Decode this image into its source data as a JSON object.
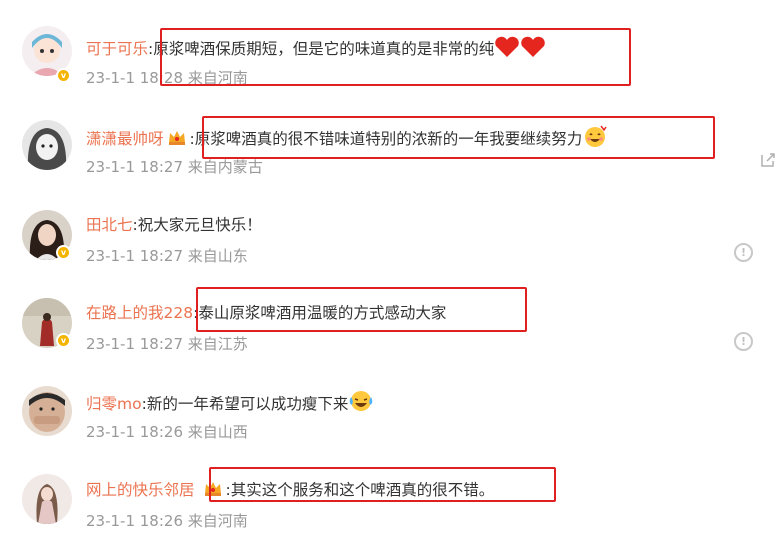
{
  "comments": [
    {
      "user": "可于可乐",
      "text": ":原浆啤酒保质期短，但是它的味道真的是非常的纯",
      "time": "23-1-1 18:28",
      "location": "来自河南",
      "avatar_color": "#e9a7b0"
    },
    {
      "user": "潇潇最帅呀",
      "text": ":原浆啤酒真的很不错味道特别的浓新的一年我要继续努力",
      "time": "23-1-1 18:27",
      "location": "来自内蒙古",
      "avatar_color": "#9a9a9a"
    },
    {
      "user": "田北七",
      "text": ":祝大家元旦快乐！",
      "time": "23-1-1 18:27",
      "location": "来自山东",
      "avatar_color": "#3b2a22"
    },
    {
      "user": "在路上的我228",
      "text": ":泰山原浆啤酒用温暖的方式感动大家",
      "time": "23-1-1 18:27",
      "location": "来自江苏",
      "avatar_color": "#7a2a28"
    },
    {
      "user": "归零mo",
      "text": ":新的一年希望可以成功瘦下来",
      "time": "23-1-1 18:26",
      "location": "来自山西",
      "avatar_color": "#c9a48a"
    },
    {
      "user": "网上的快乐邻居",
      "text": ":其实这个服务和这个啤酒真的很不错。",
      "time": "23-1-1 18:26",
      "location": "来自河南",
      "avatar_color": "#d9c3c2"
    }
  ],
  "badge_letter": "v",
  "report_icon": "!",
  "colors": {
    "username": "#eb7350",
    "text": "#333333",
    "meta": "#999999",
    "highlight_box": "#e02020"
  }
}
